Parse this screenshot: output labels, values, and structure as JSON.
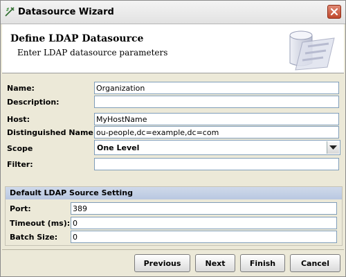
{
  "window": {
    "title": "Datasource Wizard",
    "title_icon": "wizard-icon",
    "close_icon": "close-icon"
  },
  "banner": {
    "title": "Define LDAP Datasource",
    "subtitle": "Enter LDAP datasource parameters",
    "logo": "database-cylinder-icon"
  },
  "form": {
    "name": {
      "label": "Name:",
      "value": "Organization"
    },
    "description": {
      "label": "Description:",
      "value": ""
    },
    "host": {
      "label": "Host:",
      "value": "MyHostName"
    },
    "dn": {
      "label": "Distinguished Name:",
      "value": "ou-people,dc=example,dc=com"
    },
    "scope": {
      "label": "Scope",
      "value": "One Level"
    },
    "filter": {
      "label": "Filter:",
      "value": ""
    }
  },
  "source_setting": {
    "heading": "Default LDAP Source Setting",
    "port": {
      "label": "Port:",
      "value": "389"
    },
    "timeout": {
      "label": "Timeout (ms):",
      "value": "0"
    },
    "batch": {
      "label": "Batch Size:",
      "value": "0"
    }
  },
  "buttons": {
    "previous": "Previous",
    "next": "Next",
    "finish": "Finish",
    "cancel": "Cancel"
  }
}
